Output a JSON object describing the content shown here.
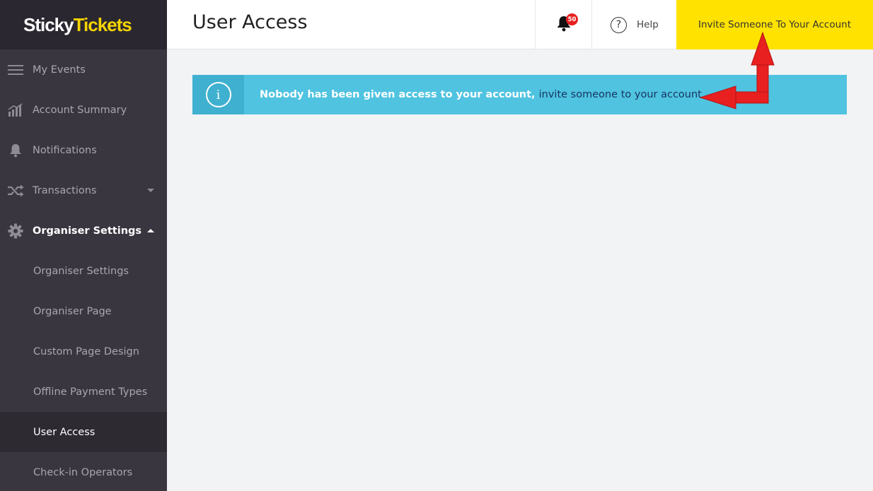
{
  "brand": {
    "name_part1": "Sticky",
    "name_part2": "Tickets"
  },
  "sidebar": {
    "items": [
      {
        "label": "My Events",
        "icon": "menu-icon"
      },
      {
        "label": "Account Summary",
        "icon": "chart-icon"
      },
      {
        "label": "Notifications",
        "icon": "bell-icon"
      },
      {
        "label": "Transactions",
        "icon": "shuffle-icon"
      },
      {
        "label": "Organiser Settings",
        "icon": "gear-icon"
      }
    ],
    "subitems": [
      {
        "label": "Organiser Settings"
      },
      {
        "label": "Organiser Page"
      },
      {
        "label": "Custom Page Design"
      },
      {
        "label": "Offline Payment Types"
      },
      {
        "label": "User Access"
      },
      {
        "label": "Check-in Operators"
      }
    ]
  },
  "header": {
    "title": "User Access",
    "notification_count": "50",
    "help_label": "Help",
    "invite_label": "Invite Someone To Your Account"
  },
  "alert": {
    "message": "Nobody has been given access to your account, ",
    "link_text": "invite someone to your account",
    "color": "#4fc3e0"
  },
  "colors": {
    "accent": "#ffe200",
    "sidebar_bg": "#3a3640",
    "annotation_arrow": "#e8201f"
  }
}
